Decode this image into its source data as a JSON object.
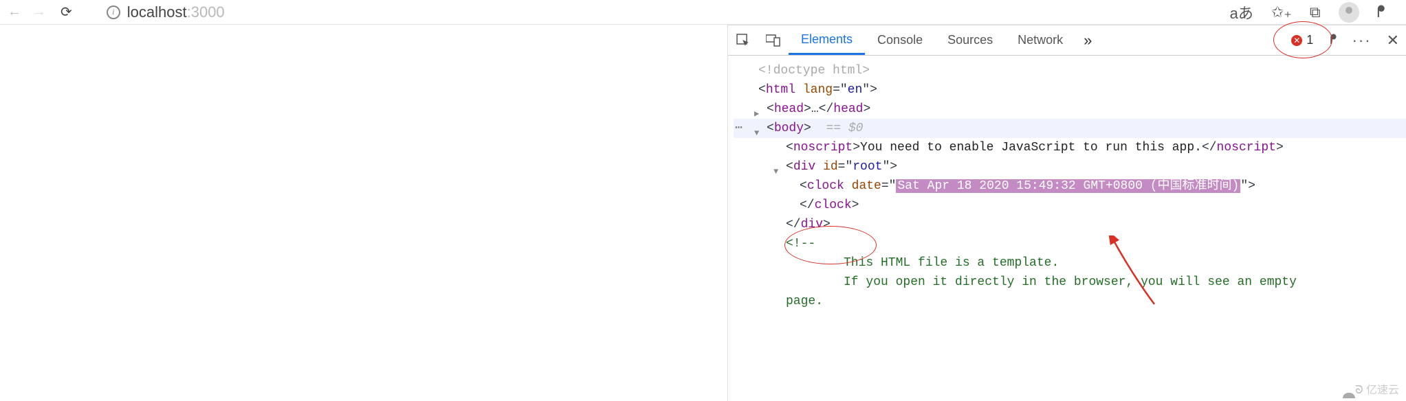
{
  "browser": {
    "url_host": "localhost",
    "url_port": ":3000",
    "icons": {
      "translate": "aあ",
      "favorite": "✩₊",
      "feedback": "⧉",
      "person": "⍥"
    }
  },
  "devtools": {
    "tabs": {
      "elements": "Elements",
      "console": "Console",
      "sources": "Sources",
      "network": "Network"
    },
    "more_chevron": "»",
    "error_count": "1",
    "menu_dots": "···",
    "close": "✕"
  },
  "dom": {
    "doctype": "<!doctype html>",
    "html_open": "html",
    "html_lang_attr": "lang",
    "html_lang_val": "en",
    "head_open": "head",
    "head_ellipsis": "…",
    "head_close": "head",
    "body_open": "body",
    "body_eq": "== $0",
    "noscript_open": "noscript",
    "noscript_text": "You need to enable JavaScript to run this app.",
    "noscript_close": "noscript",
    "divroot_tag": "div",
    "divroot_attr": "id",
    "divroot_val": "root",
    "clock_tag": "clock",
    "clock_attr": "date",
    "clock_val": "Sat Apr 18 2020 15:49:32 GMT+0800 (中国标准时间)",
    "clock_close": "clock",
    "div_close": "div",
    "comment_open": "<!--",
    "comment_l1": "This HTML file is a template.",
    "comment_l2": "If you open it directly in the browser, you will see an empty",
    "comment_l3": "page."
  },
  "watermark": {
    "text": "亿速云"
  }
}
